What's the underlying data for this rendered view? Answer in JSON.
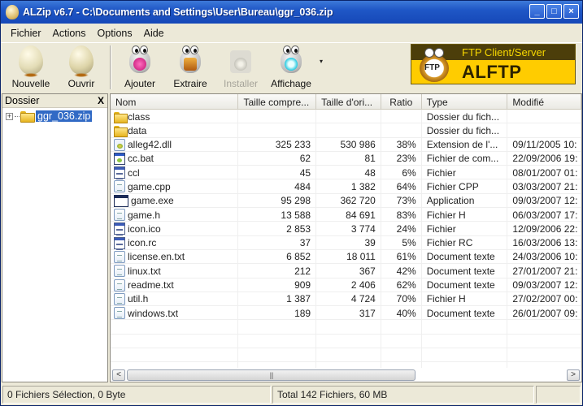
{
  "window": {
    "title": "ALZip v6.7 - C:\\Documents and Settings\\User\\Bureau\\ggr_036.zip",
    "controls": {
      "minimize": "_",
      "maximize": "□",
      "close": "×"
    }
  },
  "menu": {
    "items": [
      {
        "label": "Fichier",
        "accel": "F"
      },
      {
        "label": "Actions",
        "accel": "c"
      },
      {
        "label": "Options",
        "accel": "O"
      },
      {
        "label": "Aide",
        "accel": "A"
      }
    ]
  },
  "toolbar": {
    "buttons": [
      {
        "label": "Nouvelle",
        "icon": "egg-icon",
        "enabled": true
      },
      {
        "label": "Ouvrir",
        "icon": "cracked-egg-icon",
        "enabled": true
      },
      {
        "label": "Ajouter",
        "icon": "add-mascot-icon",
        "enabled": true
      },
      {
        "label": "Extraire",
        "icon": "extract-mascot-icon",
        "enabled": true
      },
      {
        "label": "Installer",
        "icon": "install-mascot-icon",
        "enabled": false
      },
      {
        "label": "Affichage",
        "icon": "view-mascot-icon",
        "enabled": true
      }
    ],
    "more_arrow": "▾"
  },
  "ad_banner": {
    "subtitle": "FTP Client/Server",
    "title": "ALFTP",
    "logo_text": "FTP"
  },
  "folder_pane": {
    "header": "Dossier",
    "close": "X",
    "tree": [
      {
        "label": "ggr_036.zip",
        "expander": "+",
        "selected": true
      }
    ]
  },
  "file_list": {
    "columns": [
      "Nom",
      "Taille compre...",
      "Taille d'ori...",
      "Ratio",
      "Type",
      "Modifié"
    ],
    "rows": [
      {
        "name": "class",
        "icon": "folder",
        "compressed": "",
        "original": "",
        "ratio": "",
        "type": "Dossier du fich...",
        "modified": ""
      },
      {
        "name": "data",
        "icon": "folder",
        "compressed": "",
        "original": "",
        "ratio": "",
        "type": "Dossier du fich...",
        "modified": ""
      },
      {
        "name": "alleg42.dll",
        "icon": "dll",
        "compressed": "325 233",
        "original": "530 986",
        "ratio": "38%",
        "type": "Extension de l'...",
        "modified": "09/11/2005 10:"
      },
      {
        "name": "cc.bat",
        "icon": "win",
        "compressed": "62",
        "original": "81",
        "ratio": "23%",
        "type": "Fichier de com...",
        "modified": "22/09/2006 19:"
      },
      {
        "name": "ccl",
        "icon": "bin",
        "compressed": "45",
        "original": "48",
        "ratio": "6%",
        "type": "Fichier",
        "modified": "08/01/2007 01:"
      },
      {
        "name": "game.cpp",
        "icon": "doc",
        "compressed": "484",
        "original": "1 382",
        "ratio": "64%",
        "type": "Fichier CPP",
        "modified": "03/03/2007 21:"
      },
      {
        "name": "game.exe",
        "icon": "exe",
        "compressed": "95 298",
        "original": "362 720",
        "ratio": "73%",
        "type": "Application",
        "modified": "09/03/2007 12:"
      },
      {
        "name": "game.h",
        "icon": "doc",
        "compressed": "13 588",
        "original": "84 691",
        "ratio": "83%",
        "type": "Fichier H",
        "modified": "06/03/2007 17:"
      },
      {
        "name": "icon.ico",
        "icon": "bin",
        "compressed": "2 853",
        "original": "3 774",
        "ratio": "24%",
        "type": "Fichier",
        "modified": "12/09/2006 22:"
      },
      {
        "name": "icon.rc",
        "icon": "bin",
        "compressed": "37",
        "original": "39",
        "ratio": "5%",
        "type": "Fichier RC",
        "modified": "16/03/2006 13:"
      },
      {
        "name": "license.en.txt",
        "icon": "doc",
        "compressed": "6 852",
        "original": "18 011",
        "ratio": "61%",
        "type": "Document texte",
        "modified": "24/03/2006 10:"
      },
      {
        "name": "linux.txt",
        "icon": "doc",
        "compressed": "212",
        "original": "367",
        "ratio": "42%",
        "type": "Document texte",
        "modified": "27/01/2007 21:"
      },
      {
        "name": "readme.txt",
        "icon": "doc",
        "compressed": "909",
        "original": "2 406",
        "ratio": "62%",
        "type": "Document texte",
        "modified": "09/03/2007 12:"
      },
      {
        "name": "util.h",
        "icon": "doc",
        "compressed": "1 387",
        "original": "4 724",
        "ratio": "70%",
        "type": "Fichier H",
        "modified": "27/02/2007 00:"
      },
      {
        "name": "windows.txt",
        "icon": "doc",
        "compressed": "189",
        "original": "317",
        "ratio": "40%",
        "type": "Document texte",
        "modified": "26/01/2007 09:"
      }
    ],
    "scrollbar": {
      "left": "<",
      "right": ">",
      "grip": "|||"
    }
  },
  "status_bar": {
    "selection": "0 Fichiers Sélection,  0 Byte",
    "total": "Total 142 Fichiers,  60 MB",
    "extra": ""
  },
  "colors": {
    "titlebar": "#1f57c6",
    "selection": "#316ac5",
    "ad_yellow": "#ffcc00",
    "ad_dark": "#4c3e0a"
  }
}
